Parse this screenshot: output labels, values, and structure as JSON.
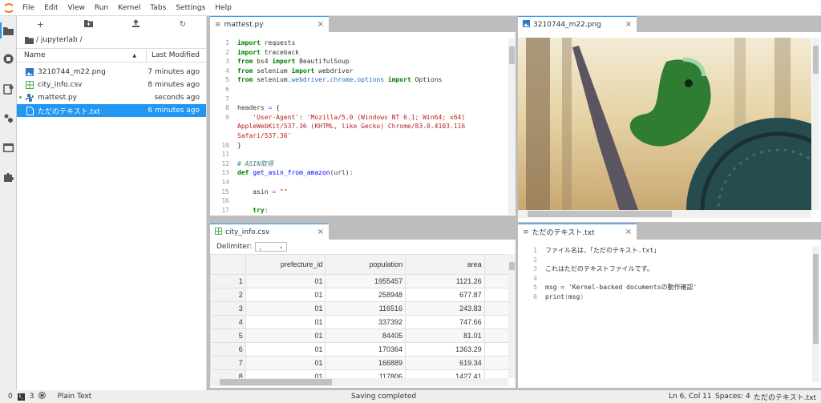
{
  "menubar": {
    "items": [
      "File",
      "Edit",
      "View",
      "Run",
      "Kernel",
      "Tabs",
      "Settings",
      "Help"
    ]
  },
  "leftbar": {
    "icons": [
      "folder-icon",
      "running-icon",
      "commands-icon",
      "property-inspector-icon",
      "tabs-icon",
      "extension-icon"
    ]
  },
  "filebrowser": {
    "toolbar": [
      "new-launcher-icon",
      "new-folder-icon",
      "upload-icon",
      "refresh-icon"
    ],
    "breadcrumb": "/ jupyterlab /",
    "columns": {
      "name": "Name",
      "modified": "Last Modified"
    },
    "files": [
      {
        "name": "3210744_m22.png",
        "modified": "7 minutes ago",
        "type": "image"
      },
      {
        "name": "city_info.csv",
        "modified": "8 minutes ago",
        "type": "csv"
      },
      {
        "name": "mattest.py",
        "modified": "seconds ago",
        "type": "python",
        "running": true
      },
      {
        "name": "ただのテキスト.txt",
        "modified": "6 minutes ago",
        "type": "text",
        "selected": true
      }
    ]
  },
  "panels": {
    "python": {
      "tab": "mattest.py",
      "close": "×"
    },
    "image": {
      "tab": "3210744_m22.png",
      "close": "×"
    },
    "csv": {
      "tab": "city_info.csv",
      "close": "×",
      "delimiter_label": "Delimiter:",
      "delimiter_value": ",",
      "headers": [
        "prefecture_id",
        "population",
        "area"
      ],
      "rows": [
        [
          "1",
          "01",
          "1955457",
          "1121.26"
        ],
        [
          "2",
          "01",
          "258948",
          "677.87"
        ],
        [
          "3",
          "01",
          "116516",
          "243.83"
        ],
        [
          "4",
          "01",
          "337392",
          "747.66"
        ],
        [
          "5",
          "01",
          "84405",
          "81.01"
        ],
        [
          "6",
          "01",
          "170364",
          "1363.29"
        ],
        [
          "7",
          "01",
          "166889",
          "619.34"
        ],
        [
          "8",
          "01",
          "117806",
          "1427.41"
        ]
      ]
    },
    "text": {
      "tab": "ただのテキスト.txt",
      "close": "×"
    }
  },
  "statusbar": {
    "kernels": "0",
    "terminals": "3",
    "mode": "Plain Text",
    "message": "Saving completed",
    "position": "Ln 6, Col 11",
    "spaces": "Spaces: 4",
    "filename": "ただのテキスト.txt"
  }
}
